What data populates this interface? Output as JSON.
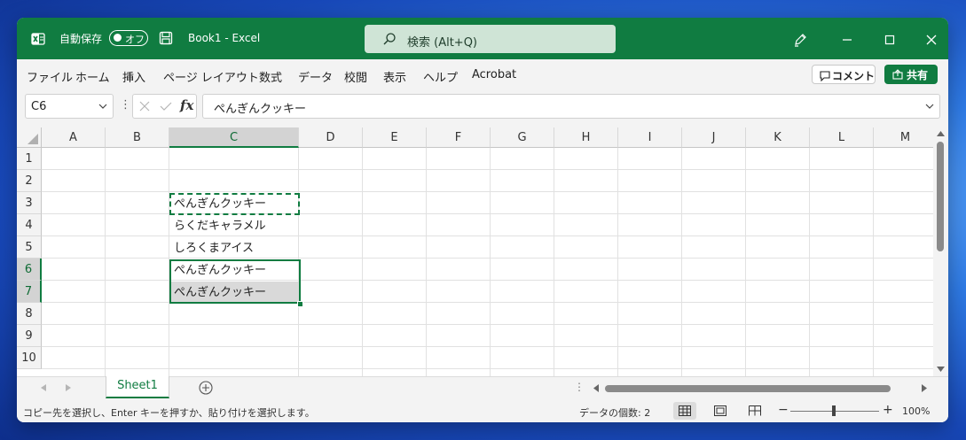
{
  "titlebar": {
    "autosave_label": "自動保存",
    "autosave_state": "オフ",
    "title": "Book1  -  Excel",
    "search_placeholder": "検索 (Alt+Q)"
  },
  "menu": [
    "ファイル",
    "ホーム",
    "挿入",
    "ページ レイアウト",
    "数式",
    "データ",
    "校閲",
    "表示",
    "ヘルプ",
    "Acrobat"
  ],
  "buttons": {
    "comment": "コメント",
    "share": "共有"
  },
  "formula_bar": {
    "name_box": "C6",
    "formula": "ぺんぎんクッキー"
  },
  "grid": {
    "columns": [
      "A",
      "B",
      "C",
      "D",
      "E",
      "F",
      "G",
      "H",
      "I",
      "J",
      "K",
      "L",
      "M"
    ],
    "rows": [
      "1",
      "2",
      "3",
      "4",
      "5",
      "6",
      "7",
      "8",
      "9",
      "10"
    ],
    "cells": {
      "C3": "ぺんぎんクッキー",
      "C4": "らくだキャラメル",
      "C5": "しろくまアイス",
      "C6": "ぺんぎんクッキー",
      "C7": "ぺんぎんクッキー"
    }
  },
  "sheets": [
    "Sheet1"
  ],
  "status": {
    "message": "コピー先を選択し、Enter キーを押すか、貼り付けを選択します。",
    "count": "データの個数: 2",
    "zoom_minus": "−",
    "zoom_plus": "+",
    "zoom": "100%"
  },
  "colors": {
    "accent": "#107c41",
    "search_bg": "#cfe4d6",
    "selection_fill": "#d9d9d9"
  }
}
